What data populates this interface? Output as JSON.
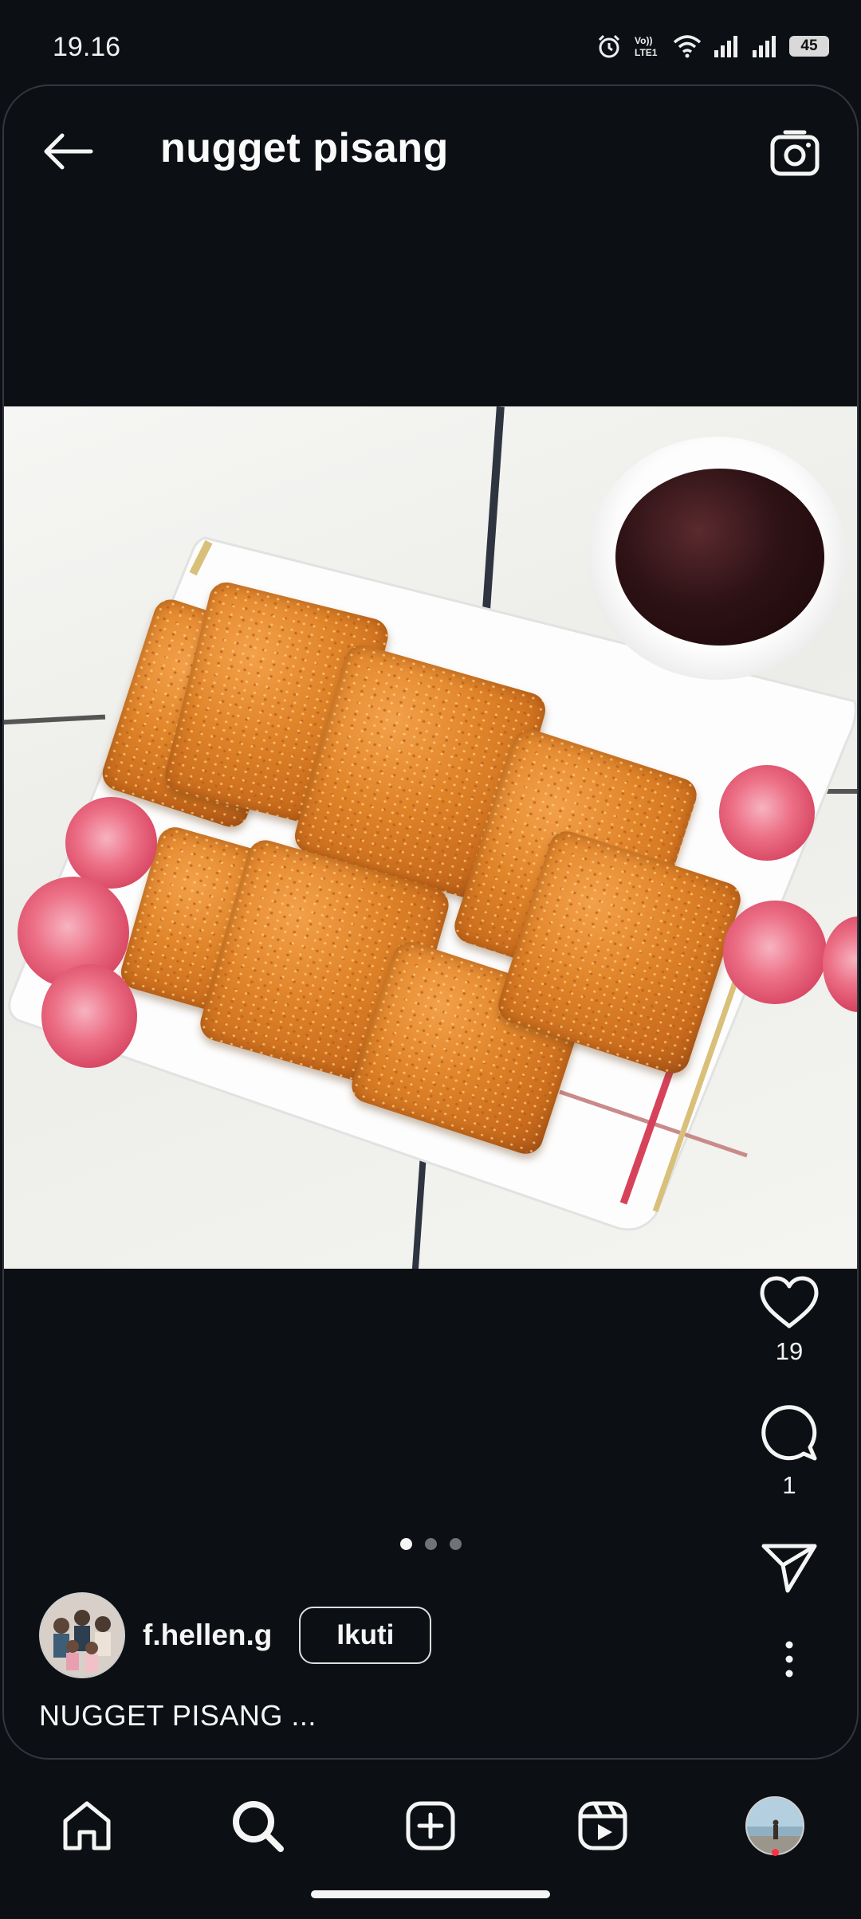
{
  "status_bar": {
    "time": "19.16",
    "battery": "45"
  },
  "header": {
    "search_query": "nugget pisang"
  },
  "post": {
    "likes": "19",
    "comments": "1",
    "carousel_pages": 3,
    "carousel_active": 1,
    "author": {
      "username": "f.hellen.g",
      "follow_label": "Ikuti"
    },
    "caption": "NUGGET PISANG ..."
  },
  "icons": {
    "back": "arrow-left-icon",
    "camera": "camera-icon",
    "like": "heart-icon",
    "comment": "comment-icon",
    "share": "send-icon",
    "more": "more-vertical-icon",
    "nav": [
      "home-icon",
      "search-icon",
      "add-post-icon",
      "reels-icon",
      "profile-avatar"
    ]
  },
  "colors": {
    "background": "#0c1014",
    "text": "#f5f5f5",
    "notification": "#ff3040"
  }
}
